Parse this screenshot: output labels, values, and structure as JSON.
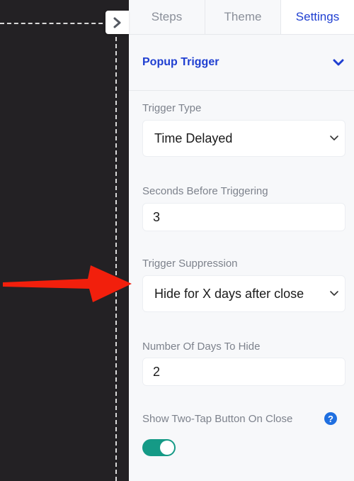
{
  "tabs": [
    {
      "label": "Steps"
    },
    {
      "label": "Theme"
    },
    {
      "label": "Settings",
      "active": true
    }
  ],
  "section": {
    "title": "Popup Trigger",
    "expanded": true
  },
  "fields": {
    "trigger_type": {
      "label": "Trigger Type",
      "value": "Time Delayed"
    },
    "seconds": {
      "label": "Seconds Before Triggering",
      "value": "3"
    },
    "suppression": {
      "label": "Trigger Suppression",
      "value": "Hide for X days after close"
    },
    "days": {
      "label": "Number Of Days To Hide",
      "value": "2"
    },
    "two_tap": {
      "label": "Show Two-Tap Button On Close",
      "help": "?",
      "enabled": true
    }
  },
  "colors": {
    "canvas": "#232124",
    "panel": "#f7f8fa",
    "accent": "#1f3fd1",
    "toggle_on": "#159a86",
    "help_icon": "#1f6fe0",
    "annotation_arrow": "#f21f0c"
  },
  "icons": {
    "collapse": "chevron-right-icon",
    "section": "chevron-down-icon",
    "select": "chevron-down-icon",
    "help": "question-circle-icon",
    "annotation": "red-arrow-icon"
  }
}
